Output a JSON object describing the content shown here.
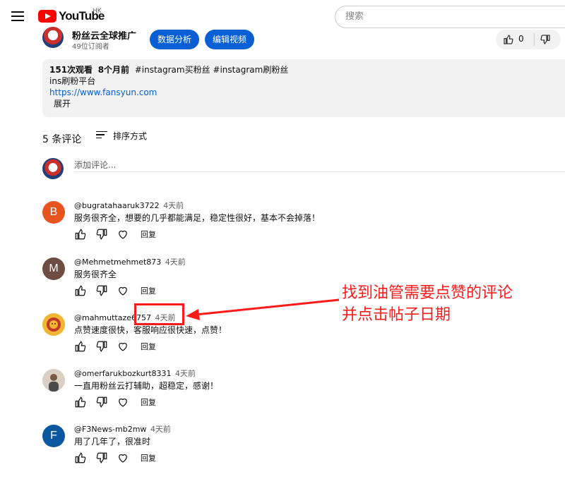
{
  "header": {
    "brand": "YouTube",
    "region": "HK",
    "search_placeholder": "搜索",
    "menu_icon": "hamburger-icon"
  },
  "channel": {
    "name": "粉丝云全球推广",
    "subscribers": "49位订阅者",
    "analytics_button": "数据分析",
    "edit_button": "编辑视频",
    "like_count": "0"
  },
  "description": {
    "views": "151次观看",
    "age": "8个月前",
    "tags": "#instagram买粉丝 #instagram刷粉丝",
    "line2": "ins刷粉平台",
    "link": "https://www.fansyun.com",
    "expand": "展开"
  },
  "comments_section": {
    "count_label": "5 条评论",
    "sort_label": "排序方式",
    "add_placeholder": "添加评论...",
    "reply_label": "回复",
    "items": [
      {
        "avatar_letter": "B",
        "avatar_color": "#e8541e",
        "author": "@bugratahaaruk3722",
        "time": "4天前",
        "text": "服务很齐全，想要的几乎都能满足，稳定性很好，基本不会掉落！"
      },
      {
        "avatar_letter": "M",
        "avatar_color": "#6d4c41",
        "author": "@Mehmetmehmet873",
        "time": "4天前",
        "text": "服务很齐全"
      },
      {
        "avatar_letter": "",
        "avatar_color": "#f2b632",
        "author": "@mahmuttaze6757",
        "time": "4天前",
        "text": "点赞速度很快，客服响应很快速，点赞！"
      },
      {
        "avatar_letter": "",
        "avatar_color": "#b3a08a",
        "author": "@omerfarukbozkurt8331",
        "time": "4天前",
        "text": "一直用粉丝云打辅助，超稳定，感谢！"
      },
      {
        "avatar_letter": "F",
        "avatar_color": "#0b57a0",
        "author": "@F3News-mb2mw",
        "time": "4天前",
        "text": "用了几年了，很准时"
      }
    ]
  },
  "annotation": {
    "line1": "找到油管需要点赞的评论",
    "line2": "并点击帖子日期",
    "color": "#ff1a1a"
  }
}
